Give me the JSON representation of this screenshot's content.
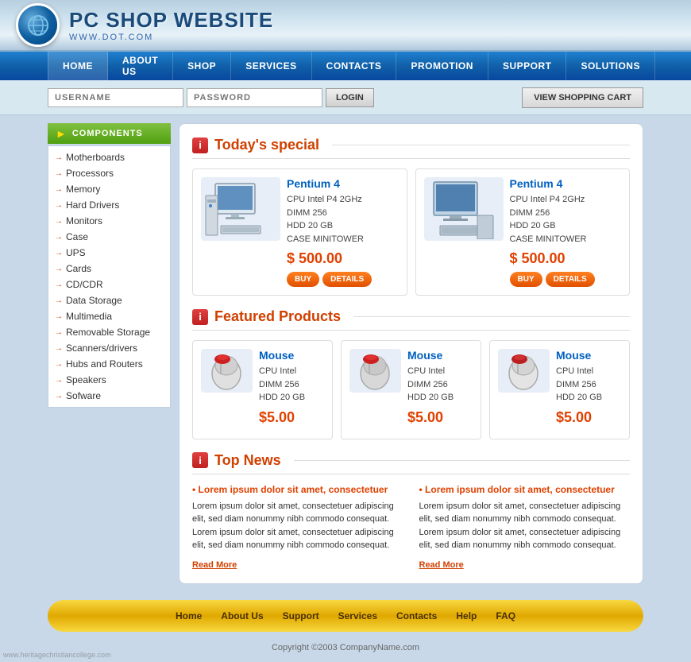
{
  "site": {
    "name": "PC SHOP WEBSITE",
    "url": "WWW.DOT.COM",
    "watermark": "www.heritagechristiancollege.com"
  },
  "nav": {
    "items": [
      "HOME",
      "ABOUT US",
      "SHOP",
      "SERVICES",
      "CONTACTS",
      "PROMOTION",
      "SUPPORT",
      "SOLUTIONS"
    ]
  },
  "login": {
    "username_placeholder": "USERNAME",
    "password_placeholder": "PASSWORD",
    "login_label": "LOGIN",
    "cart_label": "VIEW SHOPPING CART"
  },
  "sidebar": {
    "header": "COMPONENTS",
    "items": [
      "Motherboards",
      "Processors",
      "Memory",
      "Hard Drivers",
      "Monitors",
      "Case",
      "UPS",
      "Cards",
      "CD/CDR",
      "Data Storage",
      "Multimedia",
      "Removable Storage",
      "Scanners/drivers",
      "Hubs and Routers",
      "Speakers",
      "Sofware"
    ]
  },
  "todays_special": {
    "title": "Today's special",
    "products": [
      {
        "name": "Pentium 4",
        "specs": "CPU Intel P4 2GHz\nDIMM 256\nHDD 20 GB\nCASE MINITOWER",
        "price": "$ 500.00",
        "buy_label": "BUY",
        "details_label": "DETAILS"
      },
      {
        "name": "Pentium 4",
        "specs": "CPU Intel P4 2GHz\nDIMM 256\nHDD 20 GB\nCASE MINITOWER",
        "price": "$ 500.00",
        "buy_label": "BUY",
        "details_label": "DETAILS"
      }
    ]
  },
  "featured": {
    "title": "Featured Products",
    "products": [
      {
        "name": "Mouse",
        "specs": "CPU Intel\nDIMM 256\nHDD 20 GB",
        "price": "$5.00"
      },
      {
        "name": "Mouse",
        "specs": "CPU Intel\nDIMM 256\nHDD 20 GB",
        "price": "$5.00"
      },
      {
        "name": "Mouse",
        "specs": "CPU Intel\nDIMM 256\nHDD 20 GB",
        "price": "$5.00"
      }
    ]
  },
  "top_news": {
    "title": "Top News",
    "columns": [
      {
        "headline": "Lorem ipsum dolor sit amet, consectetuer",
        "body": "Lorem ipsum dolor sit amet, consectetuer adipiscing elit, sed diam nonummy nibh commodo consequat. Lorem ipsum dolor sit amet, consectetuer adipiscing elit, sed diam nonummy nibh commodo consequat.",
        "read_more": "Read More"
      },
      {
        "headline": "Lorem ipsum dolor sit amet, consectetuer",
        "body": "Lorem ipsum dolor sit amet, consectetuer adipiscing elit, sed diam nonummy nibh commodo consequat. Lorem ipsum dolor sit amet, consectetuer adipiscing elit, sed diam nonummy nibh commodo consequat.",
        "read_more": "Read More"
      }
    ]
  },
  "footer_nav": {
    "items": [
      "Home",
      "About Us",
      "Support",
      "Services",
      "Contacts",
      "Help",
      "FAQ"
    ]
  },
  "copyright": "Copyright ©2003 CompanyName.com"
}
